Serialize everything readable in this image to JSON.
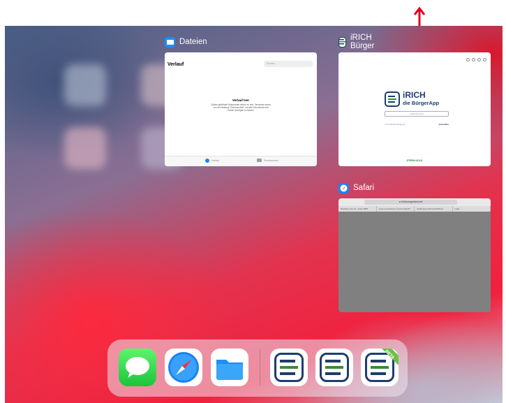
{
  "app_switcher": {
    "apps": [
      {
        "name": "Dateien"
      },
      {
        "name": "iRICH Bürger"
      },
      {
        "name": "Safari"
      }
    ]
  },
  "files_window": {
    "title": "Verlauf",
    "search_placeholder": "Suchen",
    "empty_title": "Verlauf leer",
    "empty_text": "Zuletzt geöffnete Dokumente sehen zu hier. Verwende einen von den Buttons \"Durchsuchen\" um alle Documents und Ordner anzeigen zu lassen.",
    "tabs": [
      {
        "label": "Verlauf"
      },
      {
        "label": "Durchsuchen"
      }
    ]
  },
  "irich_window": {
    "brand_line1": "iRICH",
    "brand_line2": "die BürgerApp",
    "field_placeholder": "Login-Nummer",
    "row_left": "Anmeldeberechtigung",
    "row_right": "Anmelden",
    "footer": "STERN KOLD"
  },
  "safari_window": {
    "url": "● irichbuergeritest.net",
    "tabs": [
      "Burialing.com.de - Enter BPR",
      "www.everyswhere.com/b-bottle/Pl...",
      "irichbuergersit/b-bottle/Plane",
      "Lade..."
    ]
  },
  "dock": {
    "apps": [
      "messages-icon",
      "safari-icon",
      "files-icon",
      "irich-icon",
      "irich-icon",
      "irich-beta-icon"
    ],
    "beta_label": "BETA"
  },
  "colors": {
    "accent": "#1a82f7",
    "irich_navy": "#1e3c6e",
    "arrow_red": "#e0001b"
  }
}
